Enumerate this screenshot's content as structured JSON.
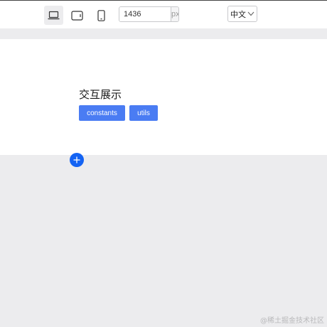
{
  "toolbar": {
    "devices": [
      {
        "name": "desktop",
        "icon": "laptop-icon",
        "active": true
      },
      {
        "name": "tablet",
        "icon": "tablet-icon",
        "active": false
      },
      {
        "name": "mobile",
        "icon": "phone-icon",
        "active": false
      }
    ],
    "width_value": "1436",
    "width_unit": "px",
    "language": "中文",
    "language_icon": "chevron-down-icon"
  },
  "content": {
    "title": "交互展示",
    "buttons": [
      "constants",
      "utils"
    ],
    "button_color": "#4a7cf3"
  },
  "add_button": {
    "icon": "plus-icon",
    "color": "#1463f3"
  },
  "watermark": "@稀土掘金技术社区"
}
